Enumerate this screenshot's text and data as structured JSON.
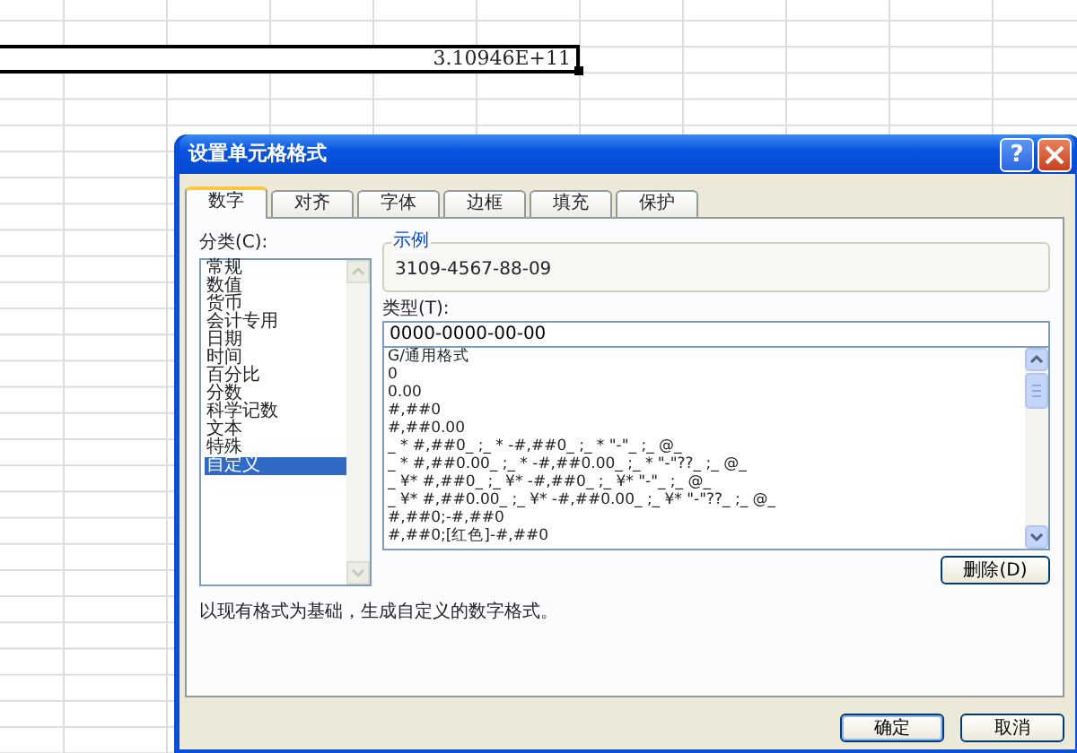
{
  "sheet": {
    "cell_value": "3.10946E+11"
  },
  "dialog": {
    "title": "设置单元格格式",
    "help_button": "?",
    "tabs": [
      {
        "label": "数字",
        "selected": true
      },
      {
        "label": "对齐",
        "selected": false
      },
      {
        "label": "字体",
        "selected": false
      },
      {
        "label": "边框",
        "selected": false
      },
      {
        "label": "填充",
        "selected": false
      },
      {
        "label": "保护",
        "selected": false
      }
    ],
    "category_label": "分类(C):",
    "categories": [
      {
        "label": "常规",
        "selected": false
      },
      {
        "label": "数值",
        "selected": false
      },
      {
        "label": "货币",
        "selected": false
      },
      {
        "label": "会计专用",
        "selected": false
      },
      {
        "label": "日期",
        "selected": false
      },
      {
        "label": "时间",
        "selected": false
      },
      {
        "label": "百分比",
        "selected": false
      },
      {
        "label": "分数",
        "selected": false
      },
      {
        "label": "科学记数",
        "selected": false
      },
      {
        "label": "文本",
        "selected": false
      },
      {
        "label": "特殊",
        "selected": false
      },
      {
        "label": "自定义",
        "selected": true
      }
    ],
    "sample_label": "示例",
    "sample_value": "3109-4567-88-09",
    "type_label": "类型(T):",
    "type_value": "0000-0000-00-00",
    "formats": [
      "G/通用格式",
      "0",
      "0.00",
      "#,##0",
      "#,##0.00",
      "_ * #,##0_ ;_ * -#,##0_ ;_ * \"-\"_ ;_ @_",
      "_ * #,##0.00_ ;_ * -#,##0.00_ ;_ * \"-\"??_ ;_ @_",
      "_ ¥* #,##0_ ;_ ¥* -#,##0_ ;_ ¥* \"-\"_ ;_ @_",
      "_ ¥* #,##0.00_ ;_ ¥* -#,##0.00_ ;_ ¥* \"-\"??_ ;_ @_",
      "#,##0;-#,##0",
      "#,##0;[红色]-#,##0"
    ],
    "delete_button": "删除(D)",
    "description": "以现有格式为基础，生成自定义的数字格式。",
    "buttons": [
      "确定",
      "取消"
    ]
  }
}
